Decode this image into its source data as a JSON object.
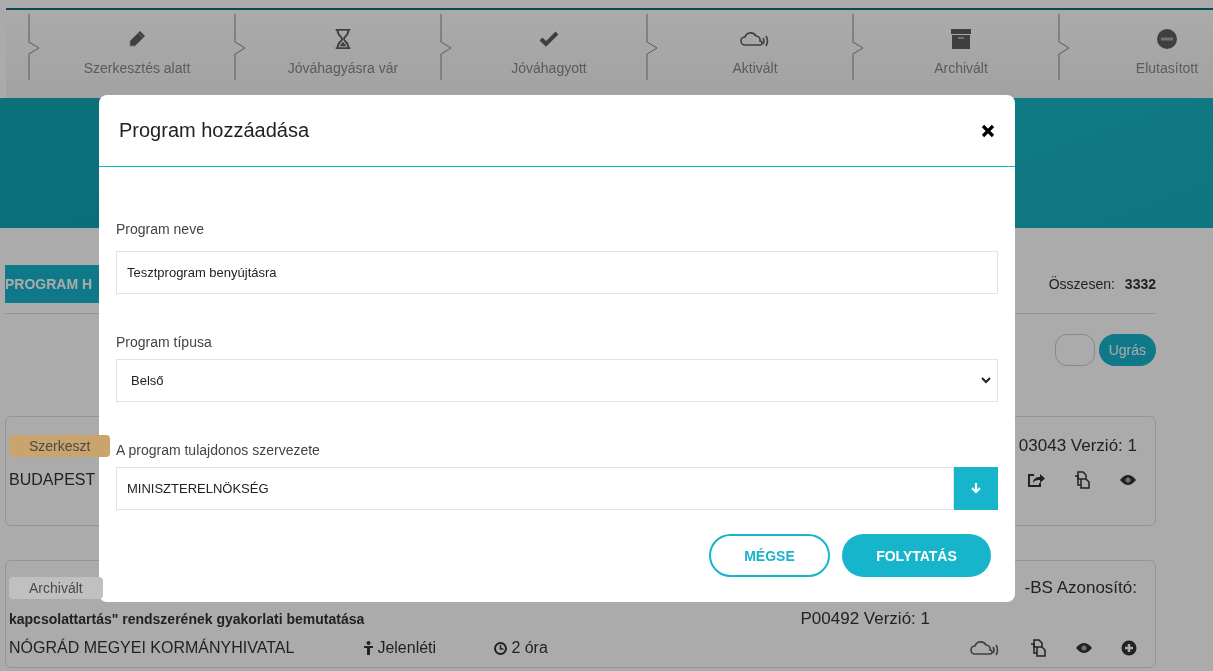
{
  "steps": [
    {
      "label": "Szerkesztés alatt",
      "kind": "pencil"
    },
    {
      "label": "Jóváhagyásra vár",
      "kind": "hourglass"
    },
    {
      "label": "Jóváhagyott",
      "kind": "check"
    },
    {
      "label": "Aktivált",
      "kind": "cloud"
    },
    {
      "label": "Archivált",
      "kind": "archive"
    },
    {
      "label": "Elutasított",
      "kind": "minus"
    }
  ],
  "add_button": "PROGRAM H",
  "total": {
    "label": "Összesen:",
    "value": "3332"
  },
  "jump": {
    "button": "Ugrás"
  },
  "cards": [
    {
      "badge": "Szerkeszt",
      "color": "#c9a46c",
      "org": "BUDAPEST",
      "id": "03043 Verzió: 1",
      "actions": [
        {
          "kind": "share"
        },
        {
          "kind": "copy"
        },
        {
          "kind": "eye"
        }
      ]
    },
    {
      "badge": "Archivált",
      "color": "#c0c0c0",
      "title": "kapcsolattartás\" rendszerének gyakorlati bemutatása",
      "org": "NÓGRÁD MEGYEI KORMÁNYHIVATAL",
      "id": "-BS Azonosító:",
      "id2": "P00492 Verzió: 1",
      "mode": "Jelenléti",
      "duration": "2 óra",
      "actions": [
        {
          "kind": "cloud"
        },
        {
          "kind": "copy"
        },
        {
          "kind": "eye"
        },
        {
          "kind": "plus"
        }
      ]
    }
  ],
  "modal": {
    "title": "Program hozzáadása",
    "fields": [
      {
        "label": "Program neve",
        "value": "Tesztprogram benyújtásra",
        "kind": "text"
      },
      {
        "label": "Program típusa",
        "value": "Belső",
        "kind": "select"
      },
      {
        "label": "A program tulajdonos szervezete",
        "value": "MINISZTERELNÖKSÉG",
        "kind": "lookup"
      }
    ],
    "buttons": [
      {
        "label": "MÉGSE",
        "kind": "secondary"
      },
      {
        "label": "FOLYTATÁS",
        "kind": "primary"
      }
    ]
  }
}
